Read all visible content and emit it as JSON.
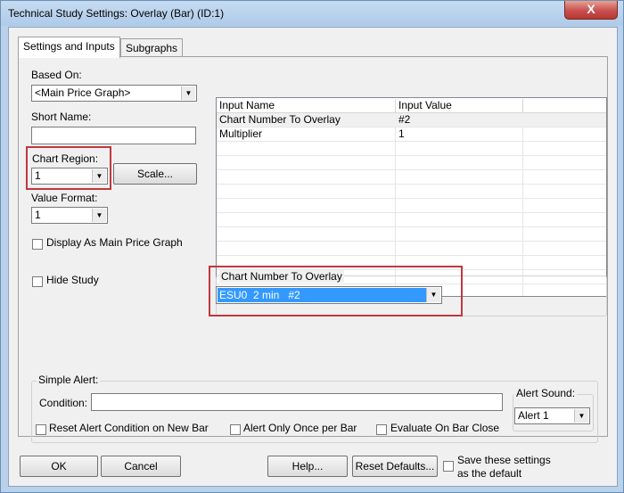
{
  "window": {
    "title": "Technical Study Settings: Overlay (Bar) (ID:1)",
    "close_glyph": "X"
  },
  "tabs": [
    {
      "label": "Settings and Inputs"
    },
    {
      "label": "Subgraphs"
    }
  ],
  "left_panel": {
    "based_on_label": "Based On:",
    "based_on_value": "<Main Price Graph>",
    "short_name_label": "Short Name:",
    "short_name_value": "",
    "chart_region_label": "Chart Region:",
    "chart_region_value": "1",
    "scale_button": "Scale...",
    "value_format_label": "Value Format:",
    "value_format_value": "1",
    "display_main_label": "Display As Main Price Graph",
    "display_main_checked": false,
    "hide_study_label": "Hide Study",
    "hide_study_checked": false
  },
  "inputs_table": {
    "columns": [
      "Input Name",
      "Input Value"
    ],
    "rows": [
      {
        "name": "Chart Number To Overlay",
        "value": "#2"
      },
      {
        "name": "Multiplier",
        "value": "1"
      }
    ]
  },
  "input_editor": {
    "label": "Chart Number To Overlay",
    "value": "ESU0  2 min   #2"
  },
  "simple_alert": {
    "label": "Simple Alert:",
    "condition_label": "Condition:",
    "condition_value": "",
    "alert_sound_label": "Alert Sound:",
    "alert_sound_value": "Alert 1",
    "reset_label": "Reset Alert Condition on New Bar",
    "once_label": "Alert Only Once per Bar",
    "evaluate_label": "Evaluate On Bar Close"
  },
  "buttons": {
    "ok": "OK",
    "cancel": "Cancel",
    "help": "Help...",
    "reset_defaults": "Reset Defaults...",
    "save_default_line1": "Save these settings",
    "save_default_line2": "as the default"
  },
  "icons": {
    "dropdown": "▼"
  },
  "colors": {
    "highlight": "#3399ff",
    "callout": "#c0383c",
    "titlebar": "#b9d1ea"
  }
}
